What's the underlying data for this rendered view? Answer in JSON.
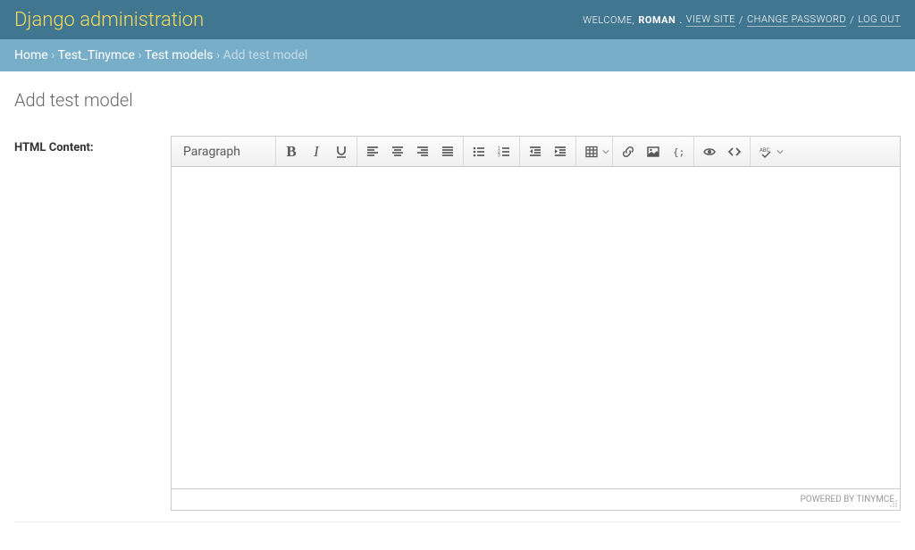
{
  "header": {
    "branding": "Django administration",
    "welcome_text": "WELCOME,",
    "user": "ROMAN",
    "period": ".",
    "links": {
      "view_site": "VIEW SITE",
      "change_password": "CHANGE PASSWORD",
      "log_out": "LOG OUT"
    }
  },
  "breadcrumbs": {
    "home": "Home",
    "app": "Test_Tinymce",
    "model": "Test models",
    "current": "Add test model",
    "sep": "›"
  },
  "page": {
    "title": "Add test model"
  },
  "form": {
    "field": {
      "label": "HTML Content:"
    }
  },
  "editor": {
    "format_select": "Paragraph",
    "statusbar": "POWERED BY TINYMCE"
  }
}
